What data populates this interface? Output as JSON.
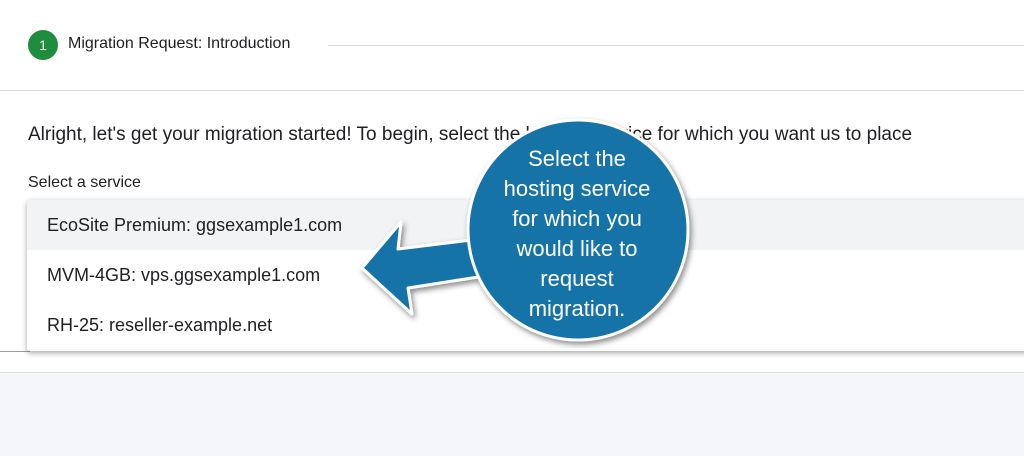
{
  "stepper": {
    "step_number": "1",
    "step_label": "Migration Request: Introduction",
    "step_color": "#1e8e3e"
  },
  "main": {
    "intro_text": "Alright, let's get your migration started! To begin, select the hosting service for which you want us to place",
    "select_label": "Select a service",
    "options": [
      {
        "label": "EcoSite Premium: ggsexample1.com",
        "highlighted": true
      },
      {
        "label": "MVM-4GB: vps.ggsexample1.com",
        "highlighted": false
      },
      {
        "label": "RH-25: reseller-example.net",
        "highlighted": false
      }
    ]
  },
  "callout": {
    "text": "Select the\nhosting service\nfor which you\nwould like to\nrequest\nmigration.",
    "color": "#1573a8"
  }
}
